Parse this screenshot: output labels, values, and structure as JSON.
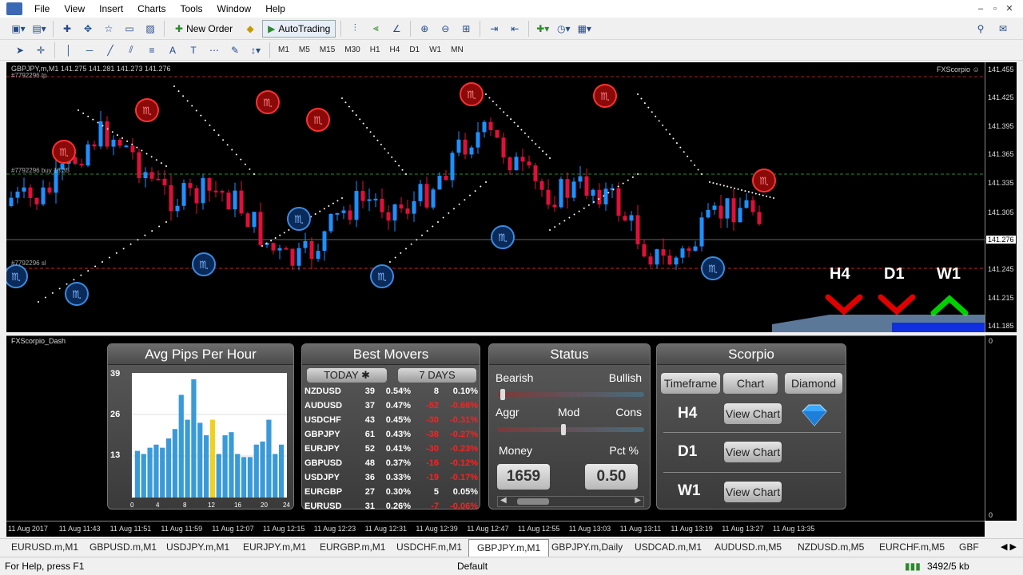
{
  "menu": [
    "File",
    "View",
    "Insert",
    "Charts",
    "Tools",
    "Window",
    "Help"
  ],
  "window_controls": [
    "–",
    "▫",
    "✕"
  ],
  "toolbar": {
    "new_order": "New Order",
    "autotrading": "AutoTrading",
    "timeframes": [
      "M1",
      "M5",
      "M15",
      "M30",
      "H1",
      "H4",
      "D1",
      "W1",
      "MN"
    ]
  },
  "chart": {
    "title": "GBPJPY,m,M1  141.275 141.281 141.273 141.276",
    "tp_label": "#7792296 tp",
    "buy_label": "#7792296 buy 18.35",
    "sl_label": "#7792296 sl",
    "indicator_label": "FXScorpio",
    "price_ticks": [
      "141.455",
      "141.425",
      "141.395",
      "141.365",
      "141.335",
      "141.305",
      "141.245",
      "141.215",
      "141.185"
    ],
    "current_price": "141.276",
    "trend_labels": [
      "H4",
      "D1",
      "W1"
    ],
    "trend_directions": [
      "down",
      "down",
      "up"
    ],
    "colors": {
      "bull": "#1e90ff",
      "bear": "#e0103a",
      "up_arrow": "#00d000",
      "down_arrow": "#e00000"
    }
  },
  "dash": {
    "name": "FXScorpio_Dash",
    "axis_top": "0",
    "axis_bottom": "0",
    "avg_pips": {
      "title": "Avg Pips Per Hour",
      "y_ticks": [
        "39",
        "26",
        "13"
      ],
      "x_ticks": [
        "0",
        "4",
        "8",
        "12",
        "16",
        "20",
        "24"
      ],
      "chart_data": {
        "type": "bar",
        "categories": [
          "0",
          "1",
          "2",
          "3",
          "4",
          "5",
          "6",
          "7",
          "8",
          "9",
          "10",
          "11",
          "12",
          "13",
          "14",
          "15",
          "16",
          "17",
          "18",
          "19",
          "20",
          "21",
          "22",
          "23"
        ],
        "values": [
          15,
          14,
          16,
          17,
          16,
          19,
          22,
          33,
          25,
          38,
          24,
          20,
          25,
          14,
          20,
          21,
          14,
          13,
          13,
          17,
          18,
          25,
          14,
          17
        ],
        "highlight_index": 12,
        "ylim": [
          0,
          39
        ]
      }
    },
    "best_movers": {
      "title": "Best Movers",
      "today_label": "TODAY ✱",
      "days_label": "7 DAYS",
      "rows": [
        {
          "sym": "NZDUSD",
          "tp": "39",
          "tpc": "0.54%",
          "wp": "8",
          "wpc": "0.10%",
          "neg": false
        },
        {
          "sym": "AUDUSD",
          "tp": "37",
          "tpc": "0.47%",
          "wp": "-52",
          "wpc": "-0.66%",
          "neg": true
        },
        {
          "sym": "USDCHF",
          "tp": "43",
          "tpc": "0.45%",
          "wp": "-30",
          "wpc": "-0.31%",
          "neg": true
        },
        {
          "sym": "GBPJPY",
          "tp": "61",
          "tpc": "0.43%",
          "wp": "-38",
          "wpc": "-0.27%",
          "neg": true
        },
        {
          "sym": "EURJPY",
          "tp": "52",
          "tpc": "0.41%",
          "wp": "-30",
          "wpc": "-0.23%",
          "neg": true
        },
        {
          "sym": "GBPUSD",
          "tp": "48",
          "tpc": "0.37%",
          "wp": "-16",
          "wpc": "-0.12%",
          "neg": true
        },
        {
          "sym": "USDJPY",
          "tp": "36",
          "tpc": "0.33%",
          "wp": "-19",
          "wpc": "-0.17%",
          "neg": true
        },
        {
          "sym": "EURGBP",
          "tp": "27",
          "tpc": "0.30%",
          "wp": "5",
          "wpc": "0.05%",
          "neg": false
        },
        {
          "sym": "EURUSD",
          "tp": "31",
          "tpc": "0.26%",
          "wp": "-7",
          "wpc": "-0.06%",
          "neg": true
        }
      ]
    },
    "status": {
      "title": "Status",
      "bearish": "Bearish",
      "bullish": "Bullish",
      "aggr": "Aggr",
      "mod": "Mod",
      "cons": "Cons",
      "money_label": "Money",
      "pct_label": "Pct %",
      "money_value": "1659",
      "pct_value": "0.50",
      "sentiment_level": 0.02,
      "risk_level": 0.45
    },
    "scorpio": {
      "title": "Scorpio",
      "tab_timeframe": "Timeframe",
      "tab_chart": "Chart",
      "tab_diamond": "Diamond",
      "rows": [
        {
          "tf": "H4",
          "btn": "View Chart"
        },
        {
          "tf": "D1",
          "btn": "View Chart"
        },
        {
          "tf": "W1",
          "btn": "View Chart"
        }
      ]
    }
  },
  "time_axis": [
    "11 Aug 2017",
    "11 Aug 11:43",
    "11 Aug 11:51",
    "11 Aug 11:59",
    "11 Aug 12:07",
    "11 Aug 12:15",
    "11 Aug 12:23",
    "11 Aug 12:31",
    "11 Aug 12:39",
    "11 Aug 12:47",
    "11 Aug 12:55",
    "11 Aug 13:03",
    "11 Aug 13:11",
    "11 Aug 13:19",
    "11 Aug 13:27",
    "11 Aug 13:35"
  ],
  "tabs": [
    {
      "label": "EURUSD.m,M1",
      "active": false
    },
    {
      "label": "GBPUSD.m,M1",
      "active": false
    },
    {
      "label": "USDJPY.m,M1",
      "active": false
    },
    {
      "label": "EURJPY.m,M1",
      "active": false
    },
    {
      "label": "EURGBP.m,M1",
      "active": false
    },
    {
      "label": "USDCHF.m,M1",
      "active": false
    },
    {
      "label": "GBPJPY.m,M1",
      "active": true
    },
    {
      "label": "GBPJPY.m,Daily",
      "active": false
    },
    {
      "label": "USDCAD.m,M1",
      "active": false
    },
    {
      "label": "AUDUSD.m,M5",
      "active": false
    },
    {
      "label": "NZDUSD.m,M5",
      "active": false
    },
    {
      "label": "EURCHF.m,M5",
      "active": false
    },
    {
      "label": "GBF",
      "active": false
    }
  ],
  "status_bar": {
    "help": "For Help, press F1",
    "profile": "Default",
    "traffic": "3492/5 kb"
  }
}
